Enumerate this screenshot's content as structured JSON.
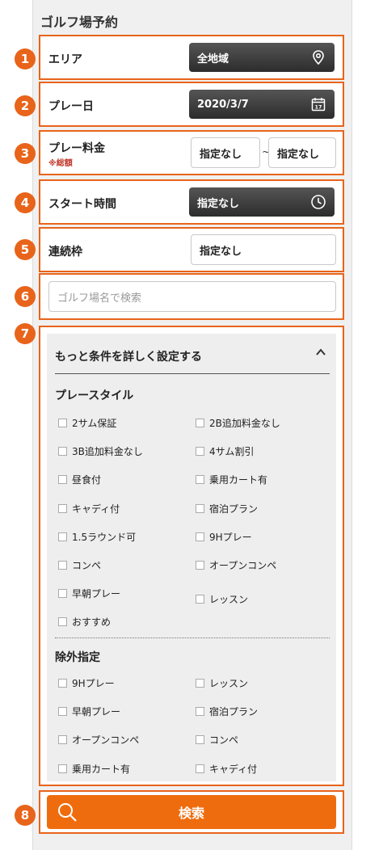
{
  "page": {
    "title": "ゴルフ場予約"
  },
  "markers": [
    "1",
    "2",
    "3",
    "4",
    "5",
    "6",
    "7",
    "8"
  ],
  "area": {
    "label": "エリア",
    "value": "全地域",
    "icon": "map-pin-icon"
  },
  "play_date": {
    "label": "プレー日",
    "value": "2020/3/7",
    "icon": "calendar-icon"
  },
  "play_fee": {
    "label": "プレー料金",
    "note": "※総額",
    "min": "指定なし",
    "separator": "~",
    "max": "指定なし"
  },
  "start_time": {
    "label": "スタート時間",
    "value": "指定なし",
    "icon": "clock-icon"
  },
  "consecutive": {
    "label": "連続枠",
    "value": "指定なし"
  },
  "course_search": {
    "placeholder": "ゴルフ場名で検索"
  },
  "more": {
    "header": "もっと条件を詳しく設定する",
    "play_style": {
      "title": "プレースタイル",
      "options": [
        "2サム保証",
        "2B追加料金なし",
        "3B追加料金なし",
        "4サム割引",
        "昼食付",
        "乗用カート有",
        "キャディ付",
        "宿泊プラン",
        "1.5ラウンド可",
        "9Hプレー",
        "コンペ",
        "オープンコンペ",
        "早朝プレー",
        "レッスン",
        "おすすめ"
      ]
    },
    "exclude": {
      "title": "除外指定",
      "options": [
        "9Hプレー",
        "レッスン",
        "早朝プレー",
        "宿泊プラン",
        "オープンコンペ",
        "コンペ",
        "乗用カート有",
        "キャディ付"
      ]
    }
  },
  "search_button": {
    "label": "検索"
  },
  "colors": {
    "accent": "#e8641a",
    "search_button": "#ef6c0e",
    "dark_button": "#3a3a3a"
  }
}
